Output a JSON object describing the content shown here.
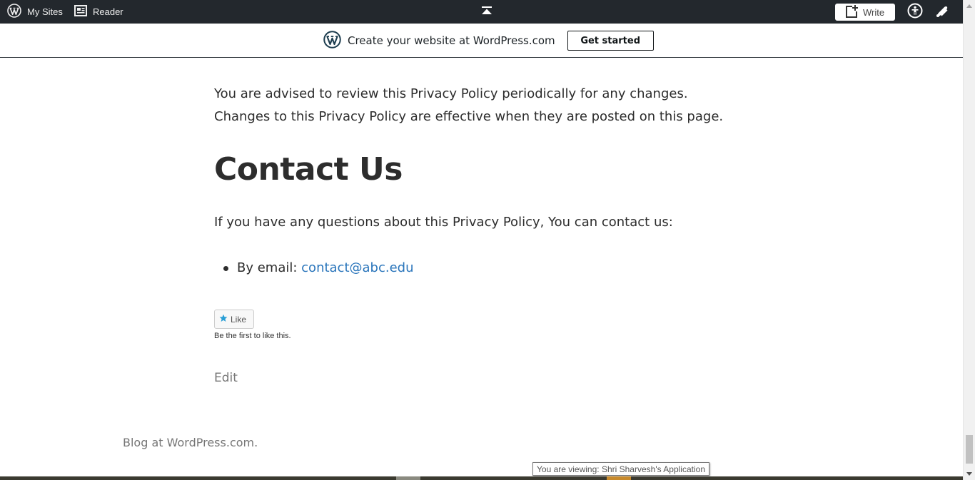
{
  "adminbar": {
    "my_sites": "My Sites",
    "reader": "Reader",
    "write": "Write"
  },
  "banner": {
    "text": "Create your website at WordPress.com",
    "button": "Get started"
  },
  "content": {
    "paragraph": "You are advised to review this Privacy Policy periodically for any changes. Changes to this Privacy Policy are effective when they are posted on this page.",
    "heading": "Contact Us",
    "contact_intro": "If you have any questions about this Privacy Policy, You can contact us:",
    "list": [
      {
        "label": "By email: ",
        "link": "contact@abc.edu"
      }
    ]
  },
  "like": {
    "button": "Like",
    "note": "Be the first to like this."
  },
  "edit": "Edit",
  "footer": {
    "credit": "Blog at WordPress.com."
  },
  "tooltip": "You are viewing: Shri Sharvesh's Application",
  "colors": {
    "adminbar_bg": "#23282d",
    "link": "#2a75bb",
    "star": "#2a9fd6"
  }
}
